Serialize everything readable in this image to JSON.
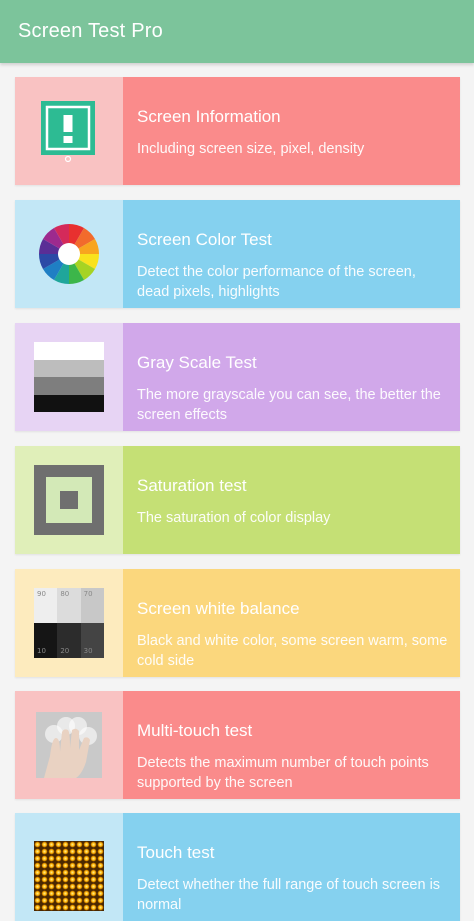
{
  "app_title": "Screen Test Pro",
  "colors": {
    "appbar": "#7cc49b",
    "pink": "#fa8b8b",
    "pink_light": "#f9c2c2",
    "blue": "#85d1ef",
    "blue_light": "#c2e7f6",
    "purple": "#d1a8ea",
    "purple_light": "#e7d4f4",
    "green": "#c5e075",
    "green_light": "#e0efb9",
    "yellow": "#fbd77d",
    "yellow_light": "#fdebbe"
  },
  "items": [
    {
      "title": "Screen Information",
      "desc": "Including screen size, pixel, density",
      "icon": "info-icon"
    },
    {
      "title": "Screen Color Test",
      "desc": "Detect the color performance of the screen, dead pixels, highlights",
      "icon": "color-wheel-icon"
    },
    {
      "title": "Gray Scale Test",
      "desc": "The more grayscale you can see, the better the screen effects",
      "icon": "grayscale-icon"
    },
    {
      "title": "Saturation test",
      "desc": "The saturation of color display",
      "icon": "saturation-icon"
    },
    {
      "title": "Screen white balance",
      "desc": "Black and white color, some screen warm, some cold side",
      "icon": "white-balance-icon",
      "swatch_labels": [
        "90",
        "80",
        "70",
        "10",
        "20",
        "30"
      ]
    },
    {
      "title": "Multi-touch test",
      "desc": "Detects the maximum number of touch points supported by the screen",
      "icon": "hand-icon"
    },
    {
      "title": "Touch test",
      "desc": "Detect whether the full range of touch screen is normal",
      "icon": "led-grid-icon"
    }
  ]
}
